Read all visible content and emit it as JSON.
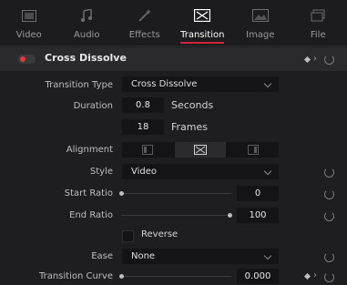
{
  "tabs": [
    {
      "label": "Video",
      "icon": "video-icon",
      "active": false
    },
    {
      "label": "Audio",
      "icon": "audio-icon",
      "active": false
    },
    {
      "label": "Effects",
      "icon": "effects-icon",
      "active": false
    },
    {
      "label": "Transition",
      "icon": "transition-icon",
      "active": true
    },
    {
      "label": "Image",
      "icon": "image-icon",
      "active": false
    },
    {
      "label": "File",
      "icon": "file-icon",
      "active": false
    }
  ],
  "header": {
    "title": "Cross Dissolve",
    "toggle_on": true
  },
  "fields": {
    "transition_type": {
      "label": "Transition Type",
      "value": "Cross Dissolve"
    },
    "duration": {
      "label": "Duration",
      "seconds": "0.8",
      "seconds_unit": "Seconds",
      "frames": "18",
      "frames_unit": "Frames"
    },
    "alignment": {
      "label": "Alignment",
      "options": [
        "align-start-icon",
        "align-center-icon",
        "align-end-icon"
      ],
      "selected": 1
    },
    "style": {
      "label": "Style",
      "value": "Video"
    },
    "start_ratio": {
      "label": "Start Ratio",
      "value": "0",
      "fraction": 0
    },
    "end_ratio": {
      "label": "End Ratio",
      "value": "100",
      "fraction": 1
    },
    "reverse": {
      "label": "Reverse",
      "checked": false
    },
    "ease": {
      "label": "Ease",
      "value": "None"
    },
    "transition_curve": {
      "label": "Transition Curve",
      "value": "0.000",
      "fraction": 0
    }
  },
  "colors": {
    "accent": "#d1243a",
    "toggle": "#e63a3a"
  }
}
